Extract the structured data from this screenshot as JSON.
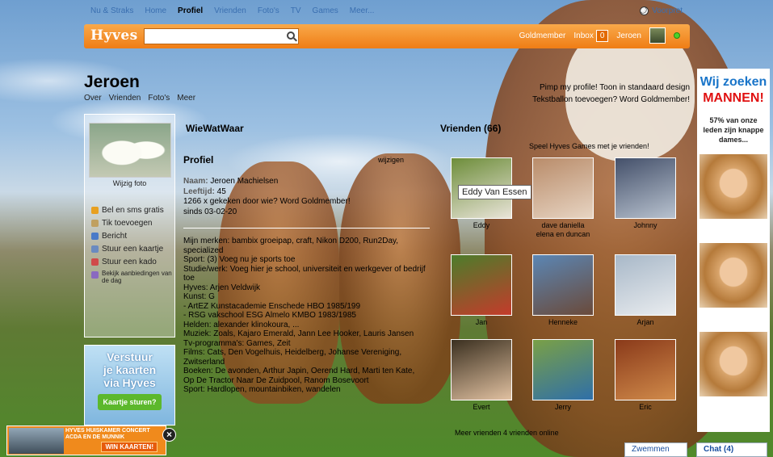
{
  "nav": {
    "items": [
      "Nu & Straks",
      "Home",
      "Profiel",
      "Vrienden",
      "Foto's",
      "TV",
      "Games",
      "Meer..."
    ],
    "active": "Profiel",
    "voorpret": "Voorpret"
  },
  "header": {
    "logo": "Hyves",
    "search_value": "",
    "goldmember": "Goldmember",
    "inbox_label": "Inbox",
    "inbox_count": "0",
    "user": "Jeroen"
  },
  "page": {
    "title": "Jeroen",
    "subnav": [
      "Over",
      "Vrienden",
      "Foto's",
      "Meer"
    ],
    "promo1": "Pimp my profile!  Toon in standaard design",
    "promo2": "Tekstballon toevoegen? Word Goldmember!"
  },
  "sidebar": {
    "wijzig_foto": "Wijzig foto",
    "menu": [
      "Bel en sms gratis",
      "Tik toevoegen",
      "Bericht",
      "Stuur een kaartje",
      "Stuur een kado",
      "Bekijk aanbiedingen van de dag"
    ]
  },
  "ad_left": {
    "line1": "Verstuur",
    "line2": "je kaarten",
    "line3": "via Hyves",
    "button": "Kaartje sturen?"
  },
  "wiewatwaar": "WieWatWaar",
  "profiel": {
    "title": "Profiel",
    "wijzigen": "wijzigen",
    "naam_label": "Naam:",
    "naam": "Jeroen Machielsen",
    "leeftijd_label": "Leeftijd:",
    "leeftijd": "45",
    "views": "1266 x gekeken door wie?",
    "goldmember": "Word Goldmember!",
    "since": "sinds 03-02-20",
    "lines": [
      "Mijn merken: bambix groeipap, craft, Nikon D200, Run2Day, specialized",
      "Sport: (3) Voeg nu je sports toe",
      "Studie/werk: Voeg hier je school, universiteit en werkgever of bedrijf toe",
      "Hyves: Arjen Veldwijk",
      "Kunst: G",
      "- ArtEZ Kunstacademie Enschede HBO 1985/199",
      "- RSG vakschool ESG Almelo KMBO 1983/1985",
      "Helden: alexander klinokoura, ...",
      "Muziek: Zoals, Kajaro Emerald, Jann Lee Hooker, Lauris Jansen",
      "Tv-programma's: Games, Zeit",
      "Films: Cats, Den Vogelhuis, Heidelberg, Johanse Vereniging, Zwitserland",
      "Boeken: De avonden, Arthur Japin, Oerend Hard, Marti ten Kate, Op De Tractor Naar De Zuidpool, Ranom Bosevoort",
      "Sport: Hardlopen, mountainbiken, wandelen"
    ]
  },
  "vrienden": {
    "title": "Vrienden (66)",
    "speel": "Speel Hyves Games met je vrienden!",
    "tooltip": "Eddy Van Essen",
    "friends": [
      {
        "name": "Eddy",
        "color1": "#6d8d3a",
        "color2": "#e9e4d8"
      },
      {
        "name": "dave daniella elena en duncan",
        "color1": "#b98c6a",
        "color2": "#e7d4c2"
      },
      {
        "name": "Johnny",
        "color1": "#44506a",
        "color2": "#b8c2cf"
      },
      {
        "name": "Jan",
        "color1": "#4c7d2b",
        "color2": "#c43b2b"
      },
      {
        "name": "Henneke",
        "color1": "#5b86b4",
        "color2": "#6a4a3a"
      },
      {
        "name": "Arjan",
        "color1": "#a8b8c8",
        "color2": "#e9ecef"
      },
      {
        "name": "Evert",
        "color1": "#3b3020",
        "color2": "#e0c0a0"
      },
      {
        "name": "Jerry",
        "color1": "#7aa046",
        "color2": "#2f6fa8"
      },
      {
        "name": "Eric",
        "color1": "#8a3a1a",
        "color2": "#d08a4a"
      }
    ],
    "footer": "Meer vrienden   4 vrienden online"
  },
  "ad_right": {
    "h1": "Wij zoeken",
    "h2": "MANNEN!",
    "p": "57% van onze leden zijn knappe dames..."
  },
  "bottom_ad": {
    "text": "HYVES HUISKAMER CONCERT ACDA EN DE MUNNIK",
    "button": "WIN KAARTEN!"
  },
  "dock": {
    "zwemmen": "Zwemmen",
    "chat": "Chat (4)"
  }
}
